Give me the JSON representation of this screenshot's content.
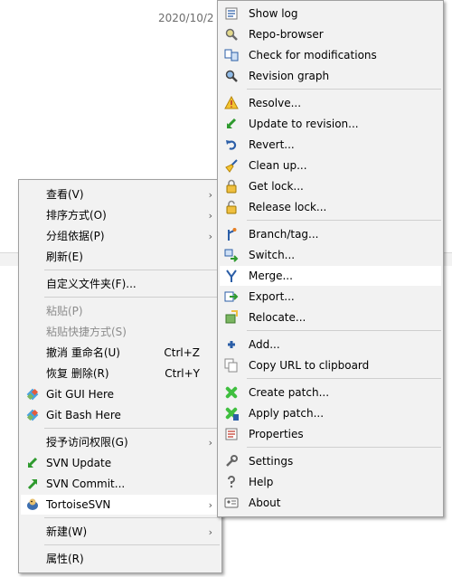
{
  "background": {
    "date": "2020/10/2"
  },
  "context_menu": {
    "items": [
      {
        "label": "查看(V)",
        "arrow": "›"
      },
      {
        "label": "排序方式(O)",
        "arrow": "›"
      },
      {
        "label": "分组依据(P)",
        "arrow": "›"
      },
      {
        "label": "刷新(E)"
      },
      {
        "label": "自定义文件夹(F)..."
      },
      {
        "label": "粘贴(P)"
      },
      {
        "label": "粘贴快捷方式(S)"
      },
      {
        "label": "撤消 重命名(U)",
        "shortcut": "Ctrl+Z"
      },
      {
        "label": "恢复 删除(R)",
        "shortcut": "Ctrl+Y"
      },
      {
        "label": "Git GUI Here"
      },
      {
        "label": "Git Bash Here"
      },
      {
        "label": "授予访问权限(G)",
        "arrow": "›"
      },
      {
        "label": "SVN Update"
      },
      {
        "label": "SVN Commit..."
      },
      {
        "label": "TortoiseSVN",
        "arrow": "›"
      },
      {
        "label": "新建(W)",
        "arrow": "›"
      },
      {
        "label": "属性(R)"
      }
    ]
  },
  "svn_menu": {
    "items": [
      {
        "label": "Show log"
      },
      {
        "label": "Repo-browser"
      },
      {
        "label": "Check for modifications"
      },
      {
        "label": "Revision graph"
      },
      {
        "label": "Resolve..."
      },
      {
        "label": "Update to revision..."
      },
      {
        "label": "Revert..."
      },
      {
        "label": "Clean up..."
      },
      {
        "label": "Get lock..."
      },
      {
        "label": "Release lock..."
      },
      {
        "label": "Branch/tag..."
      },
      {
        "label": "Switch..."
      },
      {
        "label": "Merge..."
      },
      {
        "label": "Export..."
      },
      {
        "label": "Relocate..."
      },
      {
        "label": "Add..."
      },
      {
        "label": "Copy URL to clipboard"
      },
      {
        "label": "Create patch..."
      },
      {
        "label": "Apply patch..."
      },
      {
        "label": "Properties"
      },
      {
        "label": "Settings"
      },
      {
        "label": "Help"
      },
      {
        "label": "About"
      }
    ]
  }
}
